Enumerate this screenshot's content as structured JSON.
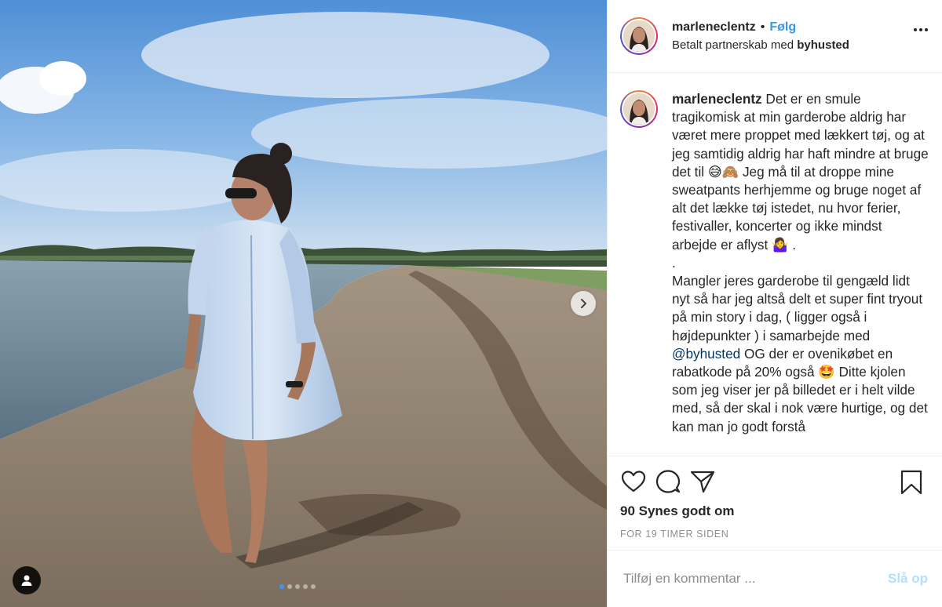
{
  "post": {
    "username": "marleneclentz",
    "bullet": "•",
    "follow_label": "Følg",
    "partner_prefix": "Betalt partnerskab med ",
    "partner_brand": "byhusted",
    "caption": {
      "user": "marleneclentz",
      "part1": " Det er en smule tragikomisk at min garderobe aldrig har været mere proppet med lækkert tøj, og at jeg samtidig aldrig har haft mindre at bruge det til 😅🙈 Jeg må til at droppe mine sweatpants herhjemme og bruge noget af alt det lække tøj istedet, nu hvor ferier, festivaller, koncerter og ikke mindst arbejde er aflyst 🤷‍♀️ .\n.\nMangler jeres garderobe til gengæld lidt nyt så har jeg altså delt et super fint tryout på min story i dag, ( ligger også i højdepunkter ) i samarbejde med ",
      "mention": "@byhusted",
      "part2": " OG der er ovenikøbet en rabatkode på 20% også 🤩 Ditte kjolen som jeg viser jer på billedet er i helt vilde med, så der skal i nok være hurtige, og det kan man jo godt forstå"
    },
    "likes": "90 Synes godt om",
    "time": "FOR 19 TIMER SIDEN",
    "comment_placeholder": "Tilføj en kommentar ...",
    "post_button": "Slå op",
    "carousel": {
      "current": 1,
      "total": 5
    }
  },
  "colors": {
    "link_blue": "#3897f0",
    "mention": "#00376b",
    "muted": "#8e8e8e",
    "post_button_disabled": "#b2dffc"
  },
  "icons": [
    "more-options-icon",
    "heart-icon",
    "comment-icon",
    "share-icon",
    "bookmark-icon",
    "chevron-right-icon",
    "user-tag-icon"
  ]
}
